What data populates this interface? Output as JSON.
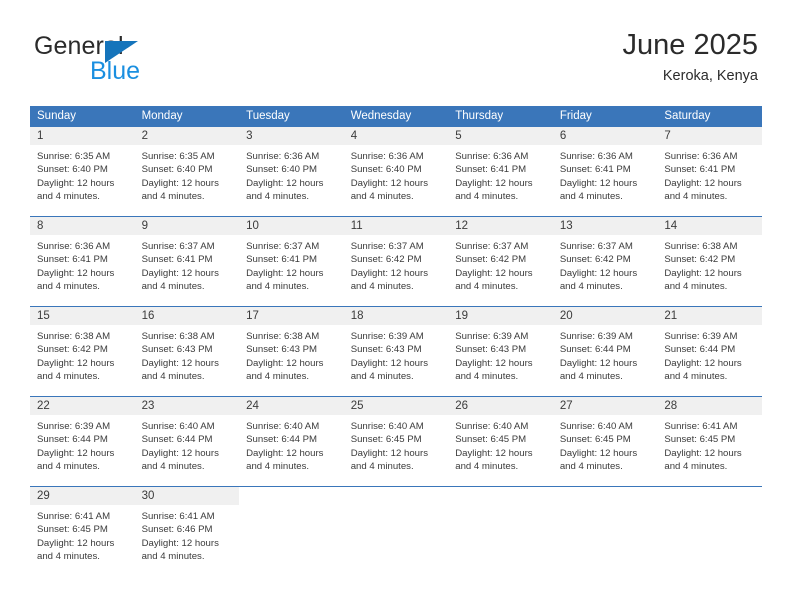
{
  "brand": {
    "name_part1": "General",
    "name_part2": "Blue",
    "triangle_icon": "triangle-icon",
    "accent_color": "#1574bb",
    "blue_text_color": "#1a8fe0"
  },
  "header": {
    "title": "June 2025",
    "subtitle": "Keroka, Kenya"
  },
  "theme": {
    "header_bg": "#3a76ba",
    "daynum_bg": "#f0f0f0",
    "text_color": "#3b3b3b",
    "page_bg": "#ffffff"
  },
  "calendar": {
    "weekday_headers": [
      "Sunday",
      "Monday",
      "Tuesday",
      "Wednesday",
      "Thursday",
      "Friday",
      "Saturday"
    ],
    "labels": {
      "sunrise": "Sunrise:",
      "sunset": "Sunset:",
      "daylight": "Daylight:"
    },
    "weeks": [
      [
        {
          "day": "1",
          "sunrise": "Sunrise: 6:35 AM",
          "sunset": "Sunset: 6:40 PM",
          "daylight_line1": "Daylight: 12 hours",
          "daylight_line2": "and 4 minutes."
        },
        {
          "day": "2",
          "sunrise": "Sunrise: 6:35 AM",
          "sunset": "Sunset: 6:40 PM",
          "daylight_line1": "Daylight: 12 hours",
          "daylight_line2": "and 4 minutes."
        },
        {
          "day": "3",
          "sunrise": "Sunrise: 6:36 AM",
          "sunset": "Sunset: 6:40 PM",
          "daylight_line1": "Daylight: 12 hours",
          "daylight_line2": "and 4 minutes."
        },
        {
          "day": "4",
          "sunrise": "Sunrise: 6:36 AM",
          "sunset": "Sunset: 6:40 PM",
          "daylight_line1": "Daylight: 12 hours",
          "daylight_line2": "and 4 minutes."
        },
        {
          "day": "5",
          "sunrise": "Sunrise: 6:36 AM",
          "sunset": "Sunset: 6:41 PM",
          "daylight_line1": "Daylight: 12 hours",
          "daylight_line2": "and 4 minutes."
        },
        {
          "day": "6",
          "sunrise": "Sunrise: 6:36 AM",
          "sunset": "Sunset: 6:41 PM",
          "daylight_line1": "Daylight: 12 hours",
          "daylight_line2": "and 4 minutes."
        },
        {
          "day": "7",
          "sunrise": "Sunrise: 6:36 AM",
          "sunset": "Sunset: 6:41 PM",
          "daylight_line1": "Daylight: 12 hours",
          "daylight_line2": "and 4 minutes."
        }
      ],
      [
        {
          "day": "8",
          "sunrise": "Sunrise: 6:36 AM",
          "sunset": "Sunset: 6:41 PM",
          "daylight_line1": "Daylight: 12 hours",
          "daylight_line2": "and 4 minutes."
        },
        {
          "day": "9",
          "sunrise": "Sunrise: 6:37 AM",
          "sunset": "Sunset: 6:41 PM",
          "daylight_line1": "Daylight: 12 hours",
          "daylight_line2": "and 4 minutes."
        },
        {
          "day": "10",
          "sunrise": "Sunrise: 6:37 AM",
          "sunset": "Sunset: 6:41 PM",
          "daylight_line1": "Daylight: 12 hours",
          "daylight_line2": "and 4 minutes."
        },
        {
          "day": "11",
          "sunrise": "Sunrise: 6:37 AM",
          "sunset": "Sunset: 6:42 PM",
          "daylight_line1": "Daylight: 12 hours",
          "daylight_line2": "and 4 minutes."
        },
        {
          "day": "12",
          "sunrise": "Sunrise: 6:37 AM",
          "sunset": "Sunset: 6:42 PM",
          "daylight_line1": "Daylight: 12 hours",
          "daylight_line2": "and 4 minutes."
        },
        {
          "day": "13",
          "sunrise": "Sunrise: 6:37 AM",
          "sunset": "Sunset: 6:42 PM",
          "daylight_line1": "Daylight: 12 hours",
          "daylight_line2": "and 4 minutes."
        },
        {
          "day": "14",
          "sunrise": "Sunrise: 6:38 AM",
          "sunset": "Sunset: 6:42 PM",
          "daylight_line1": "Daylight: 12 hours",
          "daylight_line2": "and 4 minutes."
        }
      ],
      [
        {
          "day": "15",
          "sunrise": "Sunrise: 6:38 AM",
          "sunset": "Sunset: 6:42 PM",
          "daylight_line1": "Daylight: 12 hours",
          "daylight_line2": "and 4 minutes."
        },
        {
          "day": "16",
          "sunrise": "Sunrise: 6:38 AM",
          "sunset": "Sunset: 6:43 PM",
          "daylight_line1": "Daylight: 12 hours",
          "daylight_line2": "and 4 minutes."
        },
        {
          "day": "17",
          "sunrise": "Sunrise: 6:38 AM",
          "sunset": "Sunset: 6:43 PM",
          "daylight_line1": "Daylight: 12 hours",
          "daylight_line2": "and 4 minutes."
        },
        {
          "day": "18",
          "sunrise": "Sunrise: 6:39 AM",
          "sunset": "Sunset: 6:43 PM",
          "daylight_line1": "Daylight: 12 hours",
          "daylight_line2": "and 4 minutes."
        },
        {
          "day": "19",
          "sunrise": "Sunrise: 6:39 AM",
          "sunset": "Sunset: 6:43 PM",
          "daylight_line1": "Daylight: 12 hours",
          "daylight_line2": "and 4 minutes."
        },
        {
          "day": "20",
          "sunrise": "Sunrise: 6:39 AM",
          "sunset": "Sunset: 6:44 PM",
          "daylight_line1": "Daylight: 12 hours",
          "daylight_line2": "and 4 minutes."
        },
        {
          "day": "21",
          "sunrise": "Sunrise: 6:39 AM",
          "sunset": "Sunset: 6:44 PM",
          "daylight_line1": "Daylight: 12 hours",
          "daylight_line2": "and 4 minutes."
        }
      ],
      [
        {
          "day": "22",
          "sunrise": "Sunrise: 6:39 AM",
          "sunset": "Sunset: 6:44 PM",
          "daylight_line1": "Daylight: 12 hours",
          "daylight_line2": "and 4 minutes."
        },
        {
          "day": "23",
          "sunrise": "Sunrise: 6:40 AM",
          "sunset": "Sunset: 6:44 PM",
          "daylight_line1": "Daylight: 12 hours",
          "daylight_line2": "and 4 minutes."
        },
        {
          "day": "24",
          "sunrise": "Sunrise: 6:40 AM",
          "sunset": "Sunset: 6:44 PM",
          "daylight_line1": "Daylight: 12 hours",
          "daylight_line2": "and 4 minutes."
        },
        {
          "day": "25",
          "sunrise": "Sunrise: 6:40 AM",
          "sunset": "Sunset: 6:45 PM",
          "daylight_line1": "Daylight: 12 hours",
          "daylight_line2": "and 4 minutes."
        },
        {
          "day": "26",
          "sunrise": "Sunrise: 6:40 AM",
          "sunset": "Sunset: 6:45 PM",
          "daylight_line1": "Daylight: 12 hours",
          "daylight_line2": "and 4 minutes."
        },
        {
          "day": "27",
          "sunrise": "Sunrise: 6:40 AM",
          "sunset": "Sunset: 6:45 PM",
          "daylight_line1": "Daylight: 12 hours",
          "daylight_line2": "and 4 minutes."
        },
        {
          "day": "28",
          "sunrise": "Sunrise: 6:41 AM",
          "sunset": "Sunset: 6:45 PM",
          "daylight_line1": "Daylight: 12 hours",
          "daylight_line2": "and 4 minutes."
        }
      ],
      [
        {
          "day": "29",
          "sunrise": "Sunrise: 6:41 AM",
          "sunset": "Sunset: 6:45 PM",
          "daylight_line1": "Daylight: 12 hours",
          "daylight_line2": "and 4 minutes."
        },
        {
          "day": "30",
          "sunrise": "Sunrise: 6:41 AM",
          "sunset": "Sunset: 6:46 PM",
          "daylight_line1": "Daylight: 12 hours",
          "daylight_line2": "and 4 minutes."
        },
        {
          "day": "",
          "sunrise": "",
          "sunset": "",
          "daylight_line1": "",
          "daylight_line2": ""
        },
        {
          "day": "",
          "sunrise": "",
          "sunset": "",
          "daylight_line1": "",
          "daylight_line2": ""
        },
        {
          "day": "",
          "sunrise": "",
          "sunset": "",
          "daylight_line1": "",
          "daylight_line2": ""
        },
        {
          "day": "",
          "sunrise": "",
          "sunset": "",
          "daylight_line1": "",
          "daylight_line2": ""
        },
        {
          "day": "",
          "sunrise": "",
          "sunset": "",
          "daylight_line1": "",
          "daylight_line2": ""
        }
      ]
    ]
  }
}
